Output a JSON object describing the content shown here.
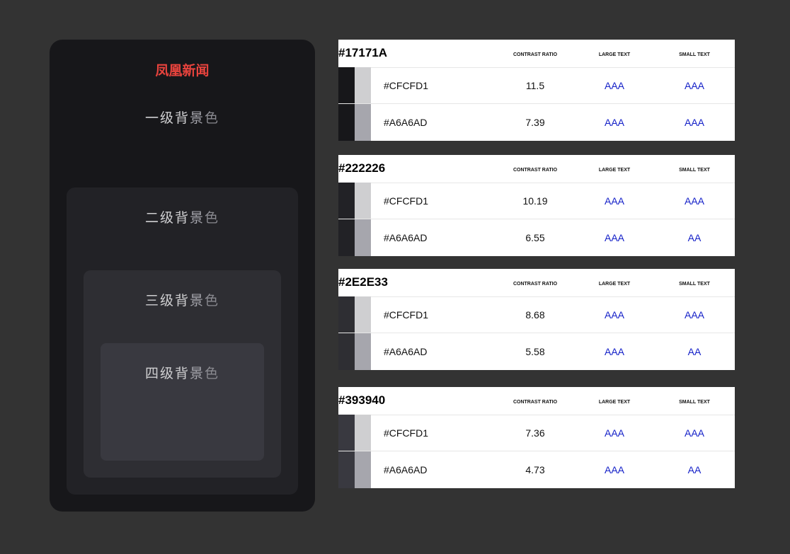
{
  "preview": {
    "brand": "凤凰新闻",
    "levels": [
      {
        "prefix": "一级",
        "c1": "背",
        "c2": "景",
        "c3": "色"
      },
      {
        "prefix": "二级",
        "c1": "背",
        "c2": "景",
        "c3": "色"
      },
      {
        "prefix": "三级",
        "c1": "背",
        "c2": "景",
        "c3": "色"
      },
      {
        "prefix": "四级",
        "c1": "背",
        "c2": "景",
        "c3": "色"
      }
    ],
    "colors": {
      "brand": "#E8433D",
      "level1_bg": "#17171A",
      "level2_bg": "#222226",
      "level3_bg": "#2E2E33",
      "level4_bg": "#393940",
      "text_primary": "#CFCFD1",
      "text_secondary": "#A6A6AD"
    }
  },
  "cards": [
    {
      "bg": "#17171A",
      "title": "#17171A",
      "headers": {
        "ratio": "CONTRAST RATIO",
        "large": "LARGE TEXT",
        "small": "SMALL TEXT"
      },
      "rows": [
        {
          "fg": "#CFCFD1",
          "hex": "#CFCFD1",
          "ratio": "11.5",
          "large": "AAA",
          "small": "AAA"
        },
        {
          "fg": "#A6A6AD",
          "hex": "#A6A6AD",
          "ratio": "7.39",
          "large": "AAA",
          "small": "AAA"
        }
      ]
    },
    {
      "bg": "#222226",
      "title": "#222226",
      "headers": {
        "ratio": "CONTRAST RATIO",
        "large": "LARGE TEXT",
        "small": "SMALL TEXT"
      },
      "rows": [
        {
          "fg": "#CFCFD1",
          "hex": "#CFCFD1",
          "ratio": "10.19",
          "large": "AAA",
          "small": "AAA"
        },
        {
          "fg": "#A6A6AD",
          "hex": "#A6A6AD",
          "ratio": "6.55",
          "large": "AAA",
          "small": "AA"
        }
      ]
    },
    {
      "bg": "#2E2E33",
      "title": "#2E2E33",
      "headers": {
        "ratio": "CONTRAST RATIO",
        "large": "LARGE TEXT",
        "small": "SMALL TEXT"
      },
      "rows": [
        {
          "fg": "#CFCFD1",
          "hex": "#CFCFD1",
          "ratio": "8.68",
          "large": "AAA",
          "small": "AAA"
        },
        {
          "fg": "#A6A6AD",
          "hex": "#A6A6AD",
          "ratio": "5.58",
          "large": "AAA",
          "small": "AA"
        }
      ]
    },
    {
      "bg": "#393940",
      "title": "#393940",
      "headers": {
        "ratio": "CONTRAST RATIO",
        "large": "LARGE TEXT",
        "small": "SMALL TEXT"
      },
      "rows": [
        {
          "fg": "#CFCFD1",
          "hex": "#CFCFD1",
          "ratio": "7.36",
          "large": "AAA",
          "small": "AAA"
        },
        {
          "fg": "#A6A6AD",
          "hex": "#A6A6AD",
          "ratio": "4.73",
          "large": "AAA",
          "small": "AA"
        }
      ]
    }
  ]
}
